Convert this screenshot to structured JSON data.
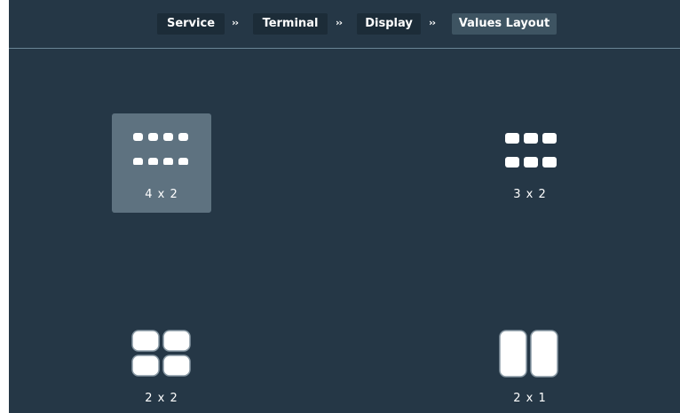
{
  "breadcrumb": {
    "items": [
      {
        "label": "Service"
      },
      {
        "label": "Terminal"
      },
      {
        "label": "Display"
      },
      {
        "label": "Values Layout"
      }
    ],
    "separator": "››"
  },
  "layouts": {
    "selected": "4 x 2",
    "options": [
      {
        "label": "4 x 2",
        "icon": "grid-4x2-icon"
      },
      {
        "label": "3 x 2",
        "icon": "grid-3x2-icon"
      },
      {
        "label": "2 x 2",
        "icon": "grid-2x2-icon"
      },
      {
        "label": "2 x 1",
        "icon": "grid-2x1-icon"
      }
    ]
  },
  "colors": {
    "background": "#253746",
    "selected_tile": "#5e7280",
    "crumb": "#1c2c38",
    "crumb_active": "#3e5462"
  }
}
